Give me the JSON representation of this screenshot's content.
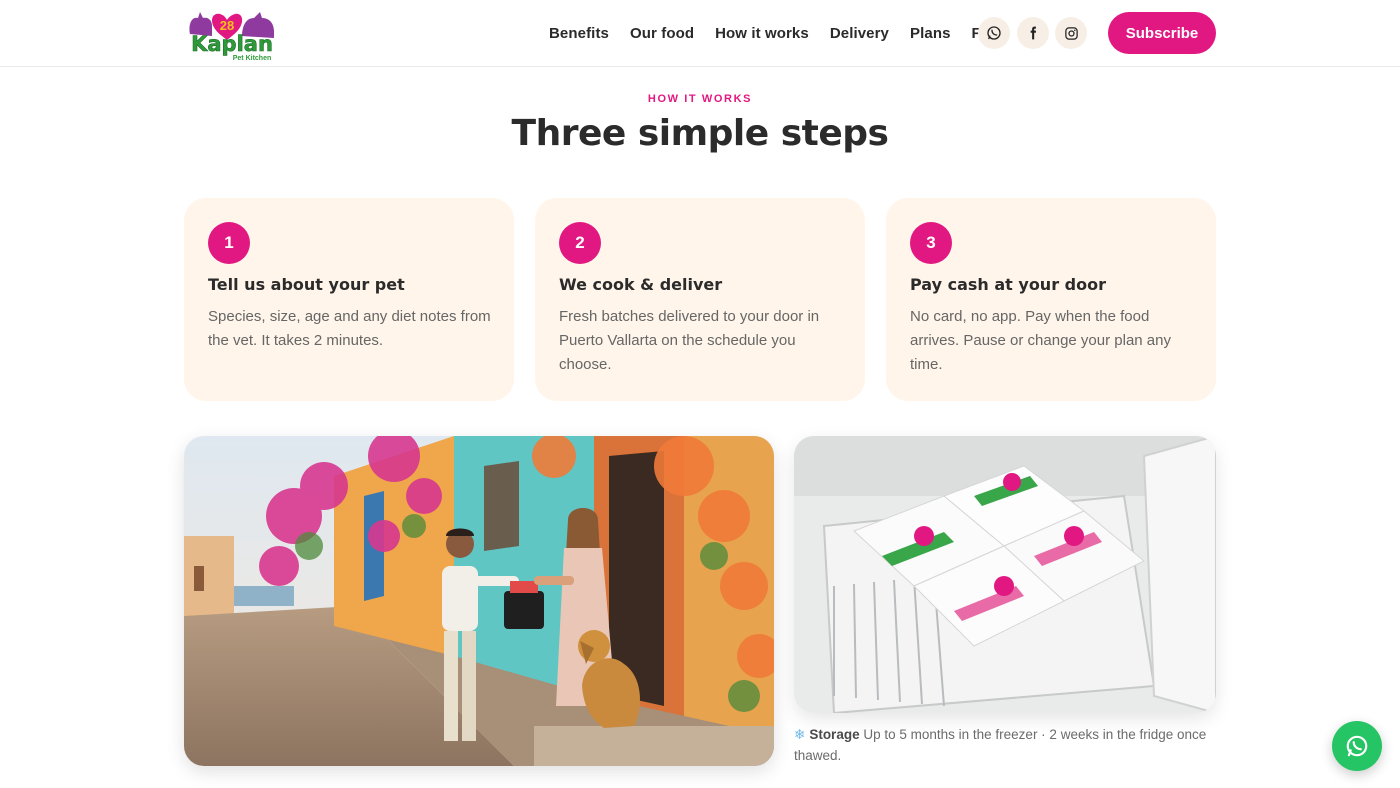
{
  "brand": {
    "logo_top": "28",
    "logo_main": "Kaplan",
    "logo_sub": "Pet Kitchen"
  },
  "nav": {
    "items": [
      "Benefits",
      "Our food",
      "How it works",
      "Delivery",
      "Plans",
      "FAQ"
    ],
    "subscribe_label": "Subscribe"
  },
  "social": {
    "icons": [
      "whatsapp-icon",
      "facebook-icon",
      "instagram-icon"
    ]
  },
  "section": {
    "eyebrow": "HOW IT WORKS",
    "title": "Three simple steps"
  },
  "steps": [
    {
      "number": "1",
      "title": "Tell us about your pet",
      "desc": "Species, size, age and any diet notes from the vet. It takes 2 minutes."
    },
    {
      "number": "2",
      "title": "We cook & deliver",
      "desc": "Fresh batches delivered to your door in Puerto Vallarta on the schedule you choose."
    },
    {
      "number": "3",
      "title": "Pay cash at your door",
      "desc": "No card, no app. Pay when the food arrives. Pause or change your plan any time."
    }
  ],
  "storage": {
    "label": "Storage",
    "text": "Up to 5 months in the freezer · 2 weeks in the fridge once thawed."
  },
  "colors": {
    "accent": "#e21882",
    "card_bg": "#fff5ea",
    "whatsapp": "#25c464"
  }
}
